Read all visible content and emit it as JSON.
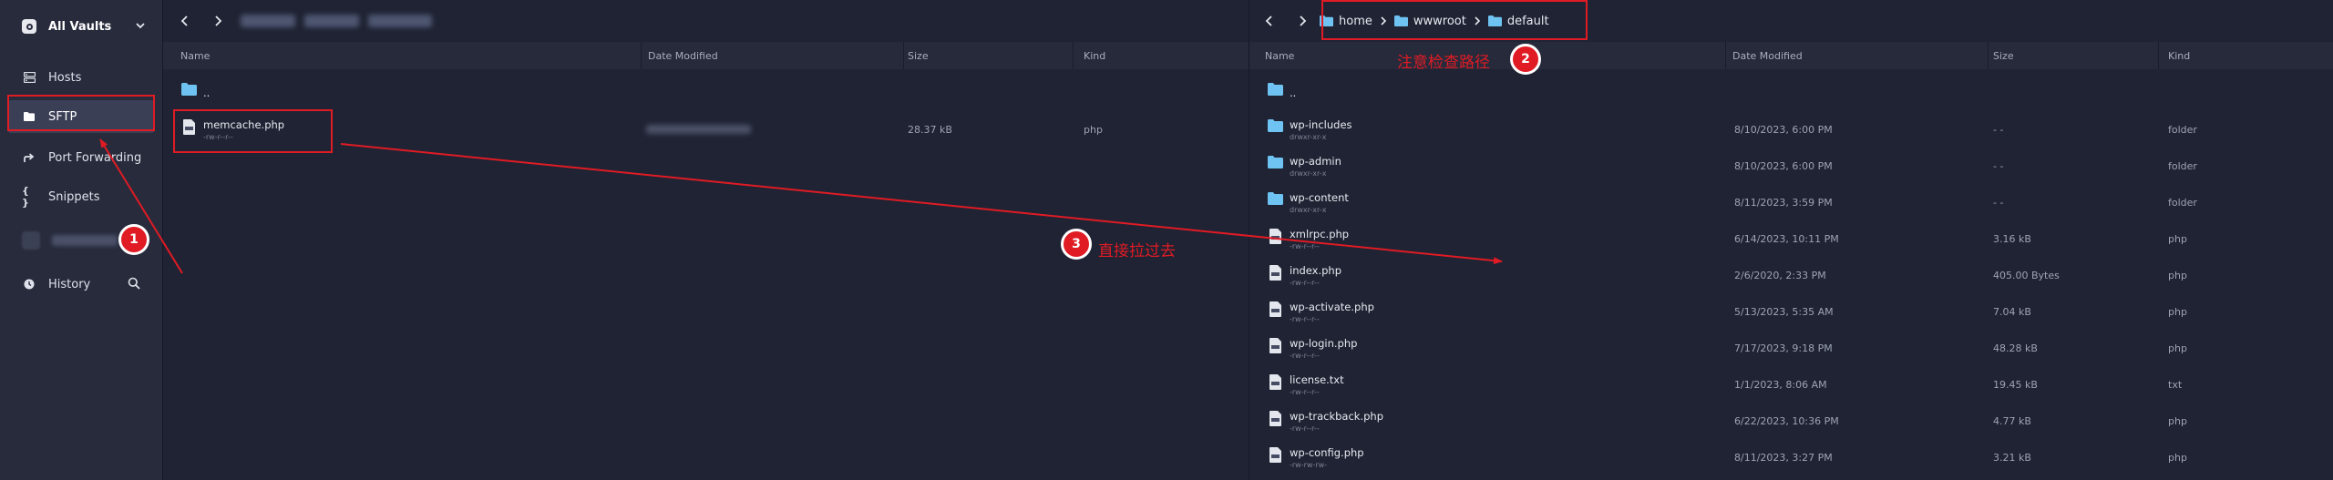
{
  "sidebar": {
    "vault_label": "All Vaults",
    "items": [
      {
        "label": "Hosts",
        "icon": "hosts-icon"
      },
      {
        "label": "SFTP",
        "icon": "folder-icon"
      },
      {
        "label": "Port Forwarding",
        "icon": "port-forwarding-icon"
      },
      {
        "label": "Snippets",
        "icon": "snippets-icon"
      },
      {
        "label": "History",
        "icon": "history-icon"
      }
    ]
  },
  "left_panel": {
    "columns": [
      "Name",
      "Date Modified",
      "Size",
      "Kind"
    ],
    "rows": [
      {
        "name": "..",
        "type": "folder"
      },
      {
        "name": "memcache.php",
        "perm": "-rw-r--r--",
        "size": "28.37 kB",
        "kind": "php"
      }
    ]
  },
  "right_panel": {
    "breadcrumb": [
      "home",
      "wwwroot",
      "default"
    ],
    "columns": [
      "Name",
      "Date Modified",
      "Size",
      "Kind"
    ],
    "rows": [
      {
        "name": "..",
        "type": "folder"
      },
      {
        "name": "wp-includes",
        "perm": "drwxr-xr-x",
        "date": "8/10/2023, 6:00 PM",
        "size": "- -",
        "kind": "folder",
        "type": "folder"
      },
      {
        "name": "wp-admin",
        "perm": "drwxr-xr-x",
        "date": "8/10/2023, 6:00 PM",
        "size": "- -",
        "kind": "folder",
        "type": "folder"
      },
      {
        "name": "wp-content",
        "perm": "drwxr-xr-x",
        "date": "8/11/2023, 3:59 PM",
        "size": "- -",
        "kind": "folder",
        "type": "folder"
      },
      {
        "name": "xmlrpc.php",
        "perm": "-rw-r--r--",
        "date": "6/14/2023, 10:11 PM",
        "size": "3.16 kB",
        "kind": "php",
        "type": "php"
      },
      {
        "name": "index.php",
        "perm": "-rw-r--r--",
        "date": "2/6/2020, 2:33 PM",
        "size": "405.00 Bytes",
        "kind": "php",
        "type": "php"
      },
      {
        "name": "wp-activate.php",
        "perm": "-rw-r--r--",
        "date": "5/13/2023, 5:35 AM",
        "size": "7.04 kB",
        "kind": "php",
        "type": "php"
      },
      {
        "name": "wp-login.php",
        "perm": "-rw-r--r--",
        "date": "7/17/2023, 9:18 PM",
        "size": "48.28 kB",
        "kind": "php",
        "type": "php"
      },
      {
        "name": "license.txt",
        "perm": "-rw-r--r--",
        "date": "1/1/2023, 8:06 AM",
        "size": "19.45 kB",
        "kind": "txt",
        "type": "txt"
      },
      {
        "name": "wp-trackback.php",
        "perm": "-rw-r--r--",
        "date": "6/22/2023, 10:36 PM",
        "size": "4.77 kB",
        "kind": "php",
        "type": "php"
      },
      {
        "name": "wp-config.php",
        "perm": "-rw-rw-rw-",
        "date": "8/11/2023, 3:27 PM",
        "size": "3.21 kB",
        "kind": "php",
        "type": "php"
      }
    ]
  },
  "annotations": {
    "badge_1": "1",
    "badge_2": "2",
    "badge_3": "3",
    "note_2": "注意检查路径",
    "note_3": "直接拉过去"
  },
  "colors": {
    "annotation_red": "#e01b24",
    "folder_blue": "#6fc3f2",
    "sidebar_bg": "#272b3c",
    "panel_bg": "#1f2333"
  }
}
